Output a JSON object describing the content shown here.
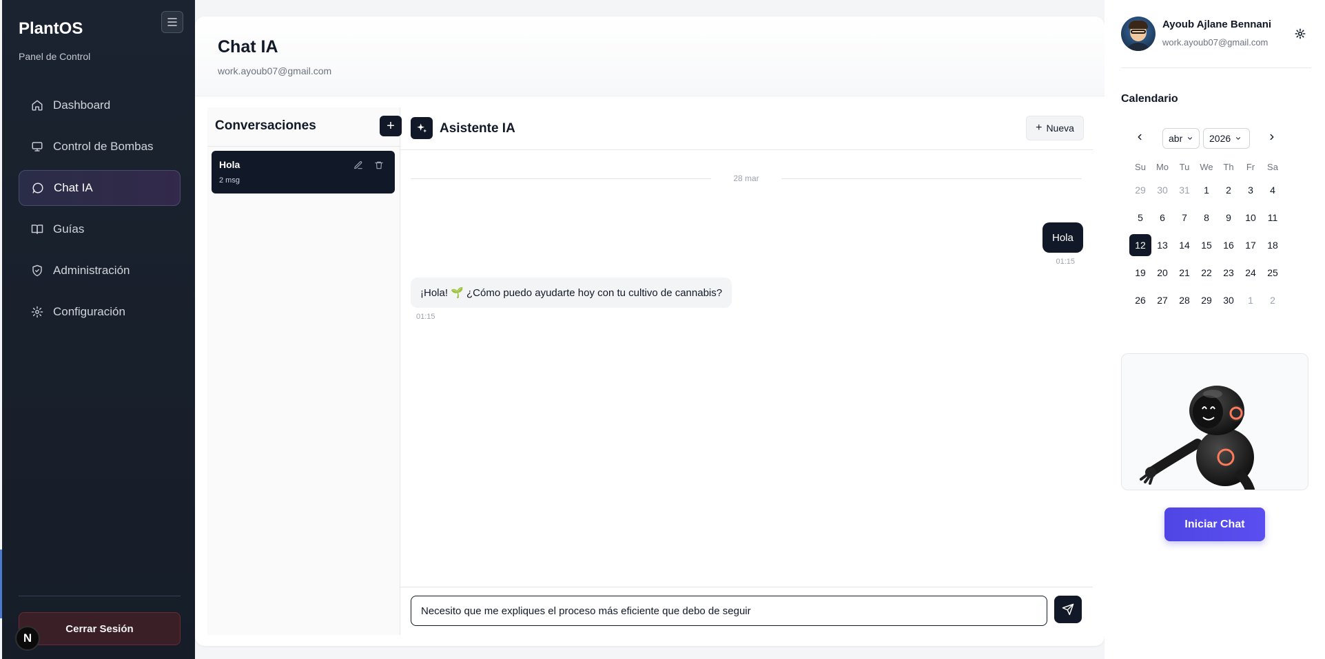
{
  "sidebar": {
    "brand": "PlantOS",
    "subtitle": "Panel de Control",
    "items": [
      {
        "label": "Dashboard",
        "icon": "home-icon"
      },
      {
        "label": "Control de Bombas",
        "icon": "monitor-icon"
      },
      {
        "label": "Chat IA",
        "icon": "message-circle-icon",
        "active": true
      },
      {
        "label": "Guías",
        "icon": "book-icon"
      },
      {
        "label": "Administración",
        "icon": "shield-icon"
      },
      {
        "label": "Configuración",
        "icon": "gear-icon"
      }
    ],
    "logout_label": "Cerrar Sesión",
    "badge_letter": "N"
  },
  "main": {
    "title": "Chat IA",
    "email": "work.ayoub07@gmail.com"
  },
  "conversations": {
    "title": "Conversaciones",
    "add_label": "+",
    "items": [
      {
        "title": "Hola",
        "count": "2 msg"
      }
    ]
  },
  "chat": {
    "title": "Asistente IA",
    "new_label": "Nueva",
    "date_label": "28 mar",
    "messages": [
      {
        "role": "user",
        "text": "Hola",
        "time": "01:15"
      },
      {
        "role": "assistant",
        "text": "¡Hola! 🌱 ¿Cómo puedo ayudarte hoy con tu cultivo de cannabis?",
        "time": "01:15"
      }
    ],
    "input_value": "Necesito que me expliques el proceso más eficiente que debo de seguir"
  },
  "profile": {
    "name": "Ayoub Ajlane Bennani",
    "email": "work.ayoub07@gmail.com"
  },
  "calendar": {
    "title": "Calendario",
    "month": "abr",
    "year": "2026",
    "weekdays": [
      "Su",
      "Mo",
      "Tu",
      "We",
      "Th",
      "Fr",
      "Sa"
    ],
    "weeks": [
      [
        "29",
        "30",
        "31",
        "1",
        "2",
        "3",
        "4"
      ],
      [
        "5",
        "6",
        "7",
        "8",
        "9",
        "10",
        "11"
      ],
      [
        "12",
        "13",
        "14",
        "15",
        "16",
        "17",
        "18"
      ],
      [
        "19",
        "20",
        "21",
        "22",
        "23",
        "24",
        "25"
      ],
      [
        "26",
        "27",
        "28",
        "29",
        "30",
        "1",
        "2"
      ]
    ],
    "today": "12"
  },
  "start_chat_label": "Iniciar Chat",
  "colors": {
    "sidebar_bg": "#1b2330",
    "accent": "#4f46e5",
    "dark": "#111827",
    "logout_bg": "#3a1f27"
  }
}
